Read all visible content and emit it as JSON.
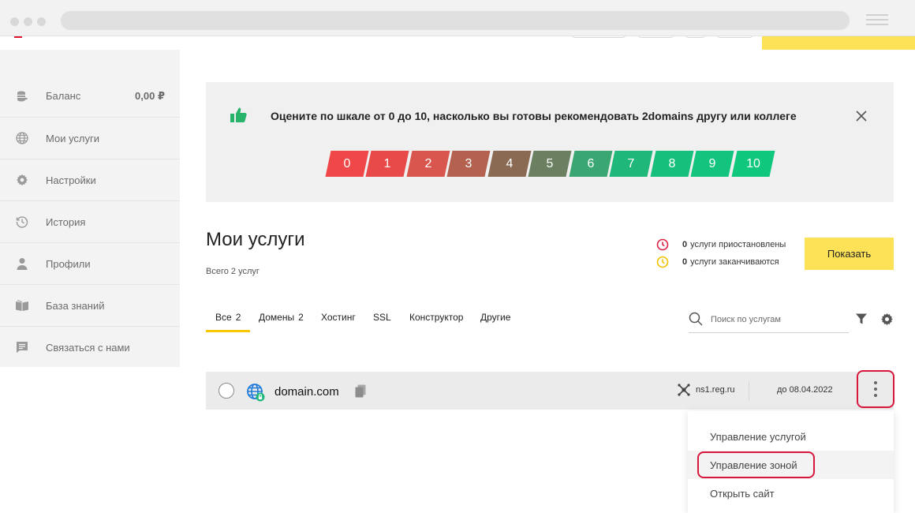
{
  "sidebar": {
    "items": [
      {
        "label": "Баланс",
        "value": "0,00 ₽",
        "icon": "coins-icon"
      },
      {
        "label": "Мои услуги",
        "icon": "globe-icon"
      },
      {
        "label": "Настройки",
        "icon": "gear-icon"
      },
      {
        "label": "История",
        "icon": "history-icon"
      },
      {
        "label": "Профили",
        "icon": "user-icon"
      },
      {
        "label": "База знаний",
        "icon": "book-icon"
      },
      {
        "label": "Связаться с нами",
        "icon": "message-icon"
      }
    ]
  },
  "nps": {
    "question": "Оцените по шкале от 0 до 10, насколько вы готовы рекомендовать 2domains другу или коллеге",
    "scale": [
      {
        "label": "0",
        "color": "#f04848"
      },
      {
        "label": "1",
        "color": "#e84a4a"
      },
      {
        "label": "2",
        "color": "#d9564e"
      },
      {
        "label": "3",
        "color": "#b46150"
      },
      {
        "label": "4",
        "color": "#8a6a52"
      },
      {
        "label": "5",
        "color": "#6a8060"
      },
      {
        "label": "6",
        "color": "#3aa772"
      },
      {
        "label": "7",
        "color": "#1fb87a"
      },
      {
        "label": "8",
        "color": "#16c07c"
      },
      {
        "label": "9",
        "color": "#12c47d"
      },
      {
        "label": "10",
        "color": "#10c77e"
      }
    ],
    "accent_color": "#27b36a"
  },
  "main": {
    "title": "Мои услуги",
    "total": "Всего 2 услуг",
    "status": {
      "suspended_count": "0",
      "suspended_text": "услуги приостановлены",
      "expiring_count": "0",
      "expiring_text": "услуги заканчиваются"
    },
    "show_button": "Показать",
    "tabs": [
      {
        "label": "Все",
        "count": "2"
      },
      {
        "label": "Домены",
        "count": "2"
      },
      {
        "label": "Хостинг",
        "count": ""
      },
      {
        "label": "SSL",
        "count": ""
      },
      {
        "label": "Конструктор",
        "count": ""
      },
      {
        "label": "Другие",
        "count": ""
      }
    ],
    "search_placeholder": "Поиск по услугам"
  },
  "row": {
    "domain": "domain.com",
    "ns": "ns1.reg.ru",
    "date": "до 08.04.2022"
  },
  "menu": {
    "items": [
      {
        "label": "Управление услугой"
      },
      {
        "label": "Управление зоной"
      },
      {
        "label": "Открыть сайт"
      }
    ]
  },
  "colors": {
    "brand_yellow": "#fde257",
    "highlight_red": "#d8173c",
    "tab_underline": "#f7c800"
  }
}
